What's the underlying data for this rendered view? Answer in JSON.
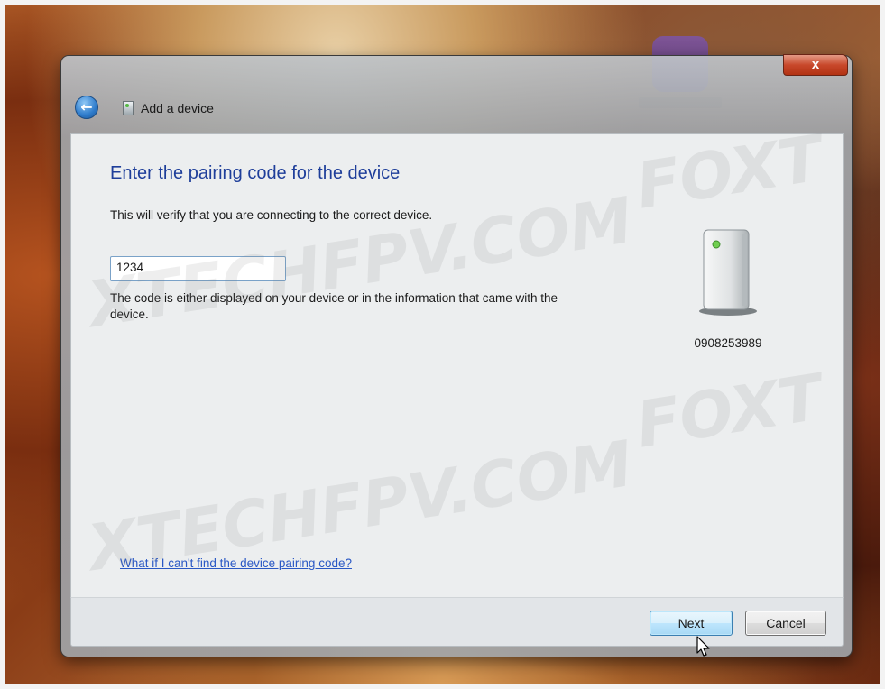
{
  "window": {
    "title": "Add a device",
    "close_symbol": "x"
  },
  "content": {
    "heading": "Enter the pairing code for the device",
    "description": "This will verify that you are connecting to the correct device.",
    "pairing_code_value": "1234",
    "help_text": "The code is either displayed on your device or in the information that came with the device.",
    "device": {
      "name": "0908253989",
      "icon": "bluetooth-device-icon"
    },
    "help_link": "What if I can't find the device pairing code?"
  },
  "footer": {
    "next_label": "Next",
    "cancel_label": "Cancel"
  },
  "watermarks": {
    "line1": "XTECHFPV.COM",
    "line2": "FOXT"
  },
  "colors": {
    "heading": "#1e3e9a",
    "link": "#2a58c5",
    "close_button": "#c8482b"
  }
}
